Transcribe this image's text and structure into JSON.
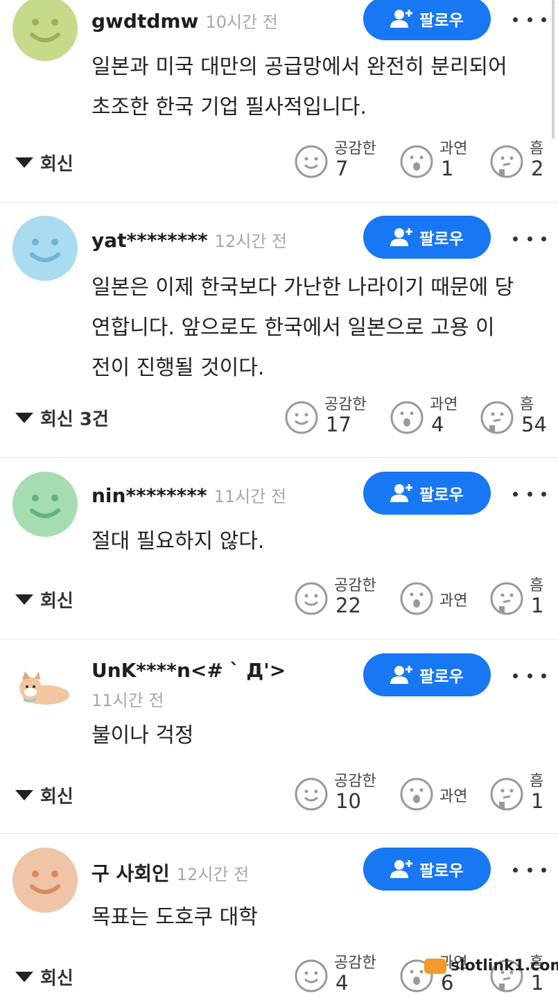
{
  "follow_label": "팔로우",
  "reaction_labels": {
    "empathy": "공감한",
    "indeed": "과연",
    "hmm": "흠"
  },
  "comments": [
    {
      "username": "gwdtdmw",
      "time": "10시간 전",
      "avatar_color": "#c5da8a",
      "lines": [
        "일본과 미국 대만의 공급망에서 완전히 분리되어",
        "초조한 한국 기업 필사적입니다."
      ],
      "reply": "회신",
      "counts": {
        "empathy": "7",
        "indeed": "1",
        "hmm": "2"
      }
    },
    {
      "username": "yat********",
      "time": "12시간 전",
      "avatar_color": "#a9dcef",
      "lines": [
        "일본은 이제 한국보다 가난한 나라이기 때문에 당",
        "연합니다. 앞으로도 한국에서 일본으로 고용 이",
        "전이 진행될 것이다."
      ],
      "reply": "회신 3건",
      "counts": {
        "empathy": "17",
        "indeed": "4",
        "hmm": "54"
      }
    },
    {
      "username": "nin********",
      "time": "11시간 전",
      "avatar_color": "#a6dcb2",
      "lines": [
        "절대 필요하지 않다."
      ],
      "reply": "회신",
      "counts": {
        "empathy": "22",
        "indeed": "",
        "hmm": "1"
      }
    },
    {
      "username": "UnK****n<# ` Д'>",
      "time": "11시간 전",
      "avatar_color": "#f0c7a0",
      "lines": [
        "불이나 걱정"
      ],
      "reply": "회신",
      "counts": {
        "empathy": "10",
        "indeed": "",
        "hmm": "1"
      }
    },
    {
      "username": "구 사회인",
      "time": "12시간 전",
      "avatar_color": "#f0c4a6",
      "lines": [
        "목표는 도호쿠 대학"
      ],
      "reply": "회신",
      "counts": {
        "empathy": "4",
        "indeed": "6",
        "hmm": "1"
      }
    }
  ],
  "watermark": "slotlink1.com"
}
